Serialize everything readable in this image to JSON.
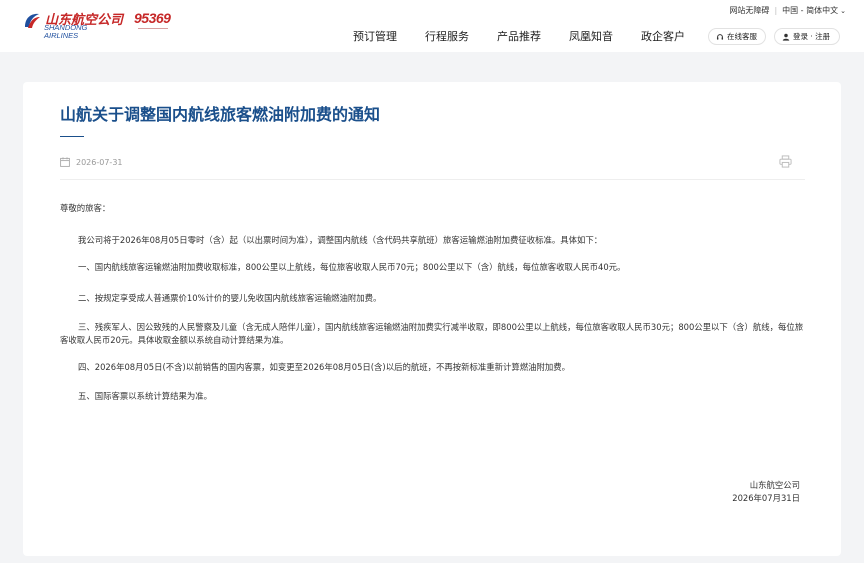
{
  "header": {
    "logo_cn": "山东航空公司",
    "logo_en_line1": "SHANDONG",
    "logo_en_line2": "AIRLINES",
    "hotline": "95369",
    "accessibility": "网站无障碍",
    "region_language": "中国 - 简体中文",
    "nav": [
      "预订管理",
      "行程服务",
      "产品推荐",
      "凤凰知音",
      "政企客户"
    ],
    "online_service": "在线客服",
    "login_register": "登录 · 注册"
  },
  "article": {
    "title": "山航关于调整国内航线旅客燃油附加费的通知",
    "date": "2026-07-31",
    "salutation": "尊敬的旅客：",
    "paragraphs": [
      "我公司将于2026年08月05日零时（含）起（以出票时间为准），调整国内航线（含代码共享航班）旅客运输燃油附加费征收标准。具体如下：",
      "一、国内航线旅客运输燃油附加费收取标准，800公里以上航线，每位旅客收取人民币70元；800公里以下（含）航线，每位旅客收取人民币40元。",
      "二、按规定享受成人普通票价10%计价的婴儿免收国内航线旅客运输燃油附加费。",
      "三、残疾军人、因公致残的人民警察及儿童（含无成人陪伴儿童），国内航线旅客运输燃油附加费实行减半收取，即800公里以上航线，每位旅客收取人民币30元；800公里以下（含）航线，每位旅客收取人民币20元。具体收取金额以系统自动计算结果为准。",
      "四、2026年08月05日(不含)以前销售的国内客票，如变更至2026年08月05日(含)以后的航班，不再按新标准重新计算燃油附加费。",
      "五、国际客票以系统计算结果为准。"
    ],
    "signature_org": "山东航空公司",
    "signature_date": "2026年07月31日"
  },
  "colors": {
    "brand_red": "#c62828",
    "brand_blue": "#1f4f9e",
    "title_blue": "#1a4f8b",
    "page_bg": "#f3f4f6"
  }
}
